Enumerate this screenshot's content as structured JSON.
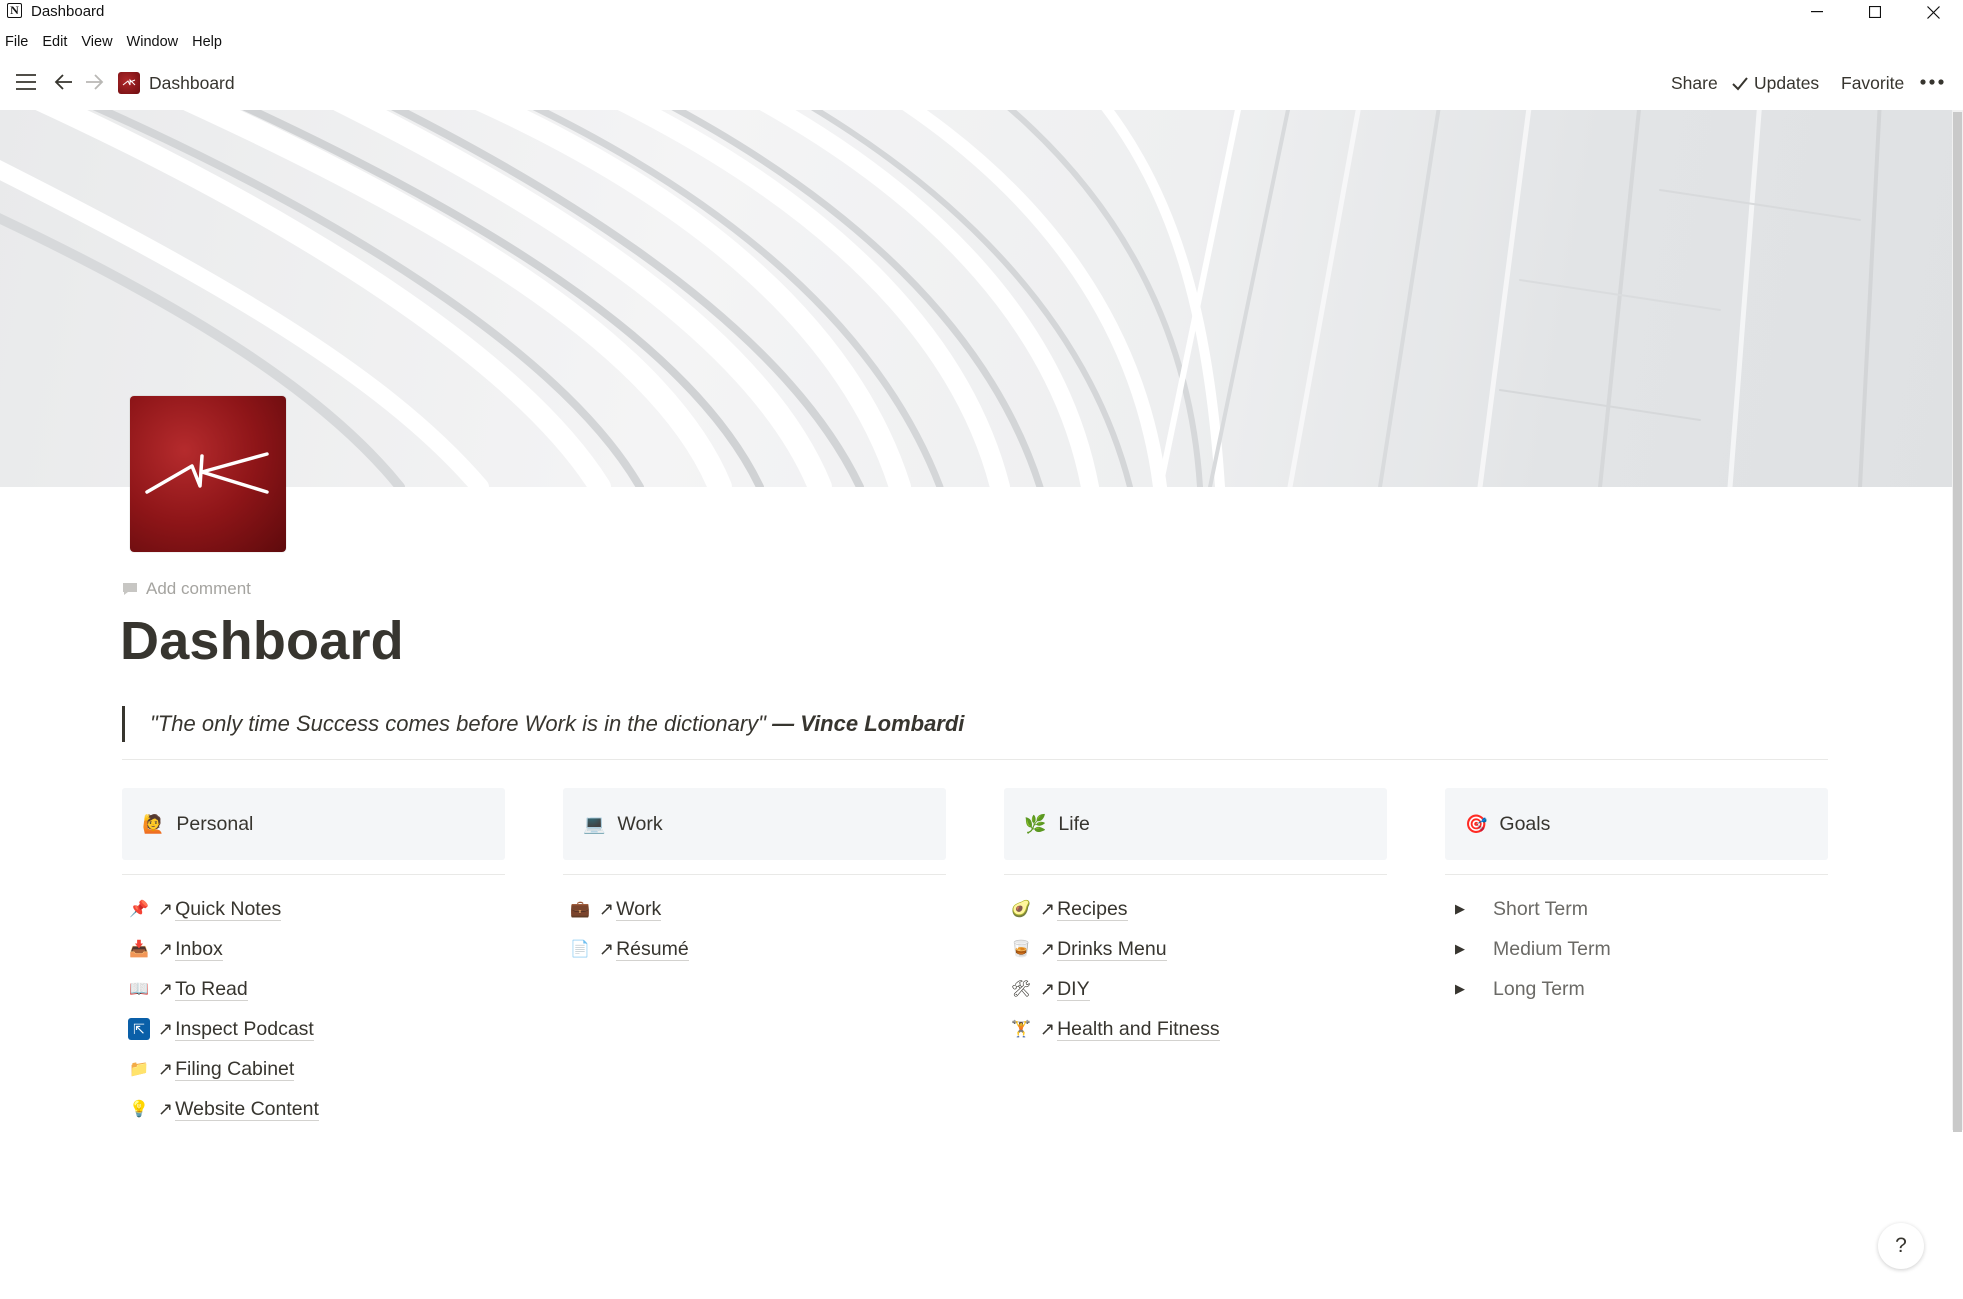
{
  "window": {
    "title": "Dashboard",
    "app_icon_letter": "N"
  },
  "menu": [
    "File",
    "Edit",
    "View",
    "Window",
    "Help"
  ],
  "topbar": {
    "breadcrumb": "Dashboard",
    "share": "Share",
    "updates": "Updates",
    "favorite": "Favorite"
  },
  "page": {
    "add_comment": "Add comment",
    "title": "Dashboard",
    "quote_text": "\"The only time Success comes before Work is in the dictionary\"",
    "quote_author": "— Vince Lombardi"
  },
  "columns": [
    {
      "header": "Personal",
      "icon": "person-raising-hand-icon",
      "emoji": "🙋",
      "items": [
        {
          "emoji": "📌",
          "icon": "pushpin-icon",
          "label": "Quick Notes"
        },
        {
          "emoji": "📥",
          "icon": "inbox-tray-icon",
          "label": "Inbox"
        },
        {
          "emoji": "📖",
          "icon": "open-book-icon",
          "label": "To Read"
        },
        {
          "emoji": "⇱",
          "icon": "inspect-podcast-logo-icon",
          "label": "Inspect Podcast"
        },
        {
          "emoji": "📁",
          "icon": "folder-icon",
          "label": "Filing Cabinet"
        },
        {
          "emoji": "💡",
          "icon": "light-bulb-icon",
          "label": "Website Content"
        }
      ]
    },
    {
      "header": "Work",
      "icon": "laptop-icon",
      "emoji": "💻",
      "items": [
        {
          "emoji": "💼",
          "icon": "briefcase-icon",
          "label": "Work"
        },
        {
          "emoji": "📄",
          "icon": "page-icon",
          "label": "Résumé"
        }
      ]
    },
    {
      "header": "Life",
      "icon": "herb-icon",
      "emoji": "🌿",
      "items": [
        {
          "emoji": "🥑",
          "icon": "avocado-icon",
          "label": "Recipes"
        },
        {
          "emoji": "🥃",
          "icon": "tumbler-glass-icon",
          "label": "Drinks Menu"
        },
        {
          "emoji": "🛠",
          "icon": "tools-icon",
          "label": "DIY"
        },
        {
          "emoji": "🏋",
          "icon": "weight-lifter-icon",
          "label": "Health and Fitness"
        }
      ]
    },
    {
      "header": "Goals",
      "icon": "target-icon",
      "emoji": "🎯",
      "toggles": [
        {
          "label": "Short Term"
        },
        {
          "label": "Medium Term"
        },
        {
          "label": "Long Term"
        }
      ]
    }
  ],
  "help": "?"
}
